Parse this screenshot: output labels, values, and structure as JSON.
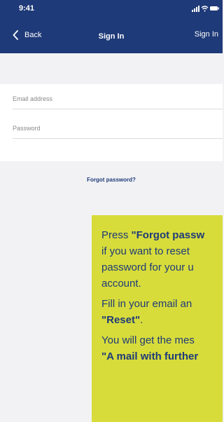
{
  "status_bar": {
    "time": "9:41"
  },
  "nav": {
    "back_label": "Back",
    "title": "Sign In",
    "action_label": "Sign In"
  },
  "form": {
    "email_placeholder": "Email address",
    "password_placeholder": "Password"
  },
  "forgot_link": "Forgot password?",
  "tooltip": {
    "p1_pre": "Press ",
    "p1_bold": "\"Forgot passw",
    "p1_line2": "if you want to reset",
    "p1_line3": "password for your u",
    "p1_line4": "account.",
    "p2_line1": "Fill in your email an",
    "p2_bold": "\"Reset\"",
    "p2_end": ".",
    "p3_line1": "You will get the mes",
    "p3_bold": "\"A mail with further"
  },
  "colors": {
    "brand_navy": "#1f3a78",
    "tooltip_yellow": "#d7dc3b",
    "background": "#f2f2f4"
  }
}
